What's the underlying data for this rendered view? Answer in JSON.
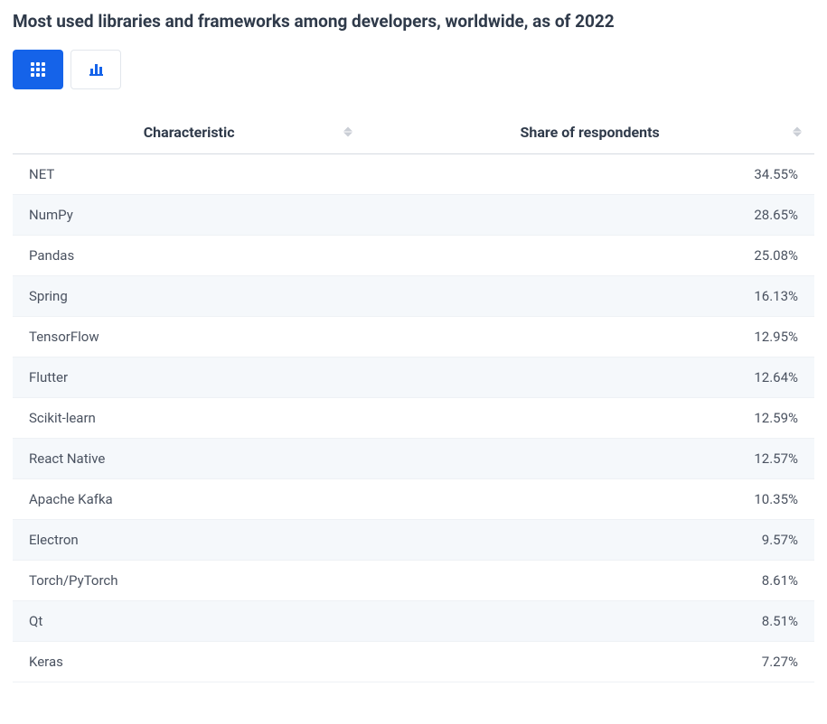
{
  "title": "Most used libraries and frameworks among developers, worldwide, as of 2022",
  "tabs": {
    "table": "table-view",
    "chart": "chart-view"
  },
  "table": {
    "headers": {
      "characteristic": "Characteristic",
      "share": "Share of respondents"
    },
    "rows": [
      {
        "name": "NET",
        "value": "34.55%"
      },
      {
        "name": "NumPy",
        "value": "28.65%"
      },
      {
        "name": "Pandas",
        "value": "25.08%"
      },
      {
        "name": "Spring",
        "value": "16.13%"
      },
      {
        "name": "TensorFlow",
        "value": "12.95%"
      },
      {
        "name": "Flutter",
        "value": "12.64%"
      },
      {
        "name": "Scikit-learn",
        "value": "12.59%"
      },
      {
        "name": "React Native",
        "value": "12.57%"
      },
      {
        "name": "Apache Kafka",
        "value": "10.35%"
      },
      {
        "name": "Electron",
        "value": "9.57%"
      },
      {
        "name": "Torch/PyTorch",
        "value": "8.61%"
      },
      {
        "name": "Qt",
        "value": "8.51%"
      },
      {
        "name": "Keras",
        "value": "7.27%"
      }
    ]
  },
  "chart_data": {
    "type": "table",
    "title": "Most used libraries and frameworks among developers, worldwide, as of 2022",
    "xlabel": "Characteristic",
    "ylabel": "Share of respondents",
    "categories": [
      "NET",
      "NumPy",
      "Pandas",
      "Spring",
      "TensorFlow",
      "Flutter",
      "Scikit-learn",
      "React Native",
      "Apache Kafka",
      "Electron",
      "Torch/PyTorch",
      "Qt",
      "Keras"
    ],
    "values": [
      34.55,
      28.65,
      25.08,
      16.13,
      12.95,
      12.64,
      12.59,
      12.57,
      10.35,
      9.57,
      8.61,
      8.51,
      7.27
    ],
    "unit": "%"
  }
}
